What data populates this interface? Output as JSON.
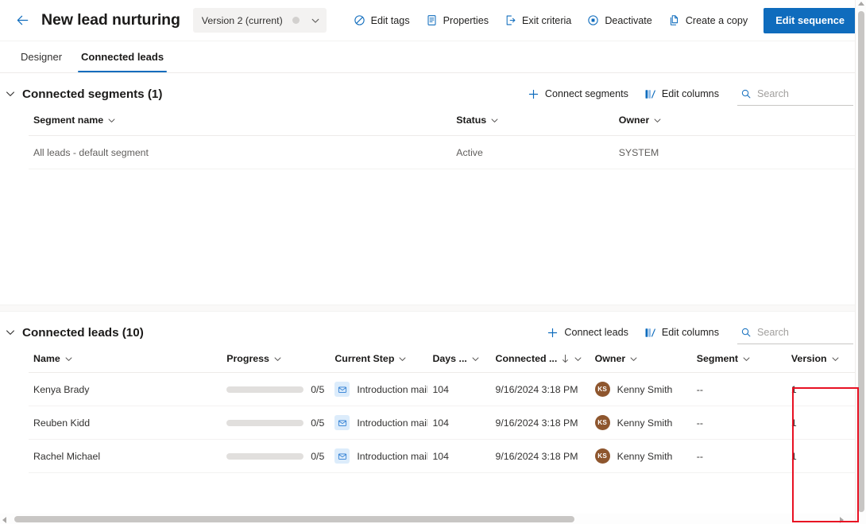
{
  "header": {
    "back_icon": "arrow-left-icon",
    "title": "New lead nurturing",
    "version_selector": {
      "label": "Version 2 (current)",
      "chevron_icon": "chevron-down-icon"
    },
    "actions": [
      {
        "label": "Edit tags",
        "icon": "tag-icon"
      },
      {
        "label": "Properties",
        "icon": "document-properties-icon"
      },
      {
        "label": "Exit criteria",
        "icon": "exit-icon"
      },
      {
        "label": "Deactivate",
        "icon": "circle-stop-icon"
      },
      {
        "label": "Create a copy",
        "icon": "copy-icon"
      }
    ],
    "primary_action": {
      "label": "Edit sequence",
      "color": "#0f6cbd"
    }
  },
  "tabs": [
    {
      "label": "Designer",
      "active": false
    },
    {
      "label": "Connected leads",
      "active": true
    }
  ],
  "segments_section": {
    "title": "Connected segments (1)",
    "chevron_icon": "chevron-down-icon",
    "tools": [
      {
        "label": "Connect segments",
        "icon": "plus-icon"
      },
      {
        "label": "Edit columns",
        "icon": "edit-columns-icon"
      }
    ],
    "search": {
      "placeholder": "Search",
      "value": "",
      "icon": "search-icon"
    },
    "columns": [
      {
        "label": "Segment name",
        "sortable": true
      },
      {
        "label": "Status",
        "sortable": true
      },
      {
        "label": "Owner",
        "sortable": true
      }
    ],
    "rows": [
      {
        "segment_name": "All leads - default segment",
        "status": "Active",
        "owner": "SYSTEM"
      }
    ]
  },
  "leads_section": {
    "title": "Connected leads (10)",
    "chevron_icon": "chevron-down-icon",
    "tools": [
      {
        "label": "Connect leads",
        "icon": "plus-icon"
      },
      {
        "label": "Edit columns",
        "icon": "edit-columns-icon"
      }
    ],
    "search": {
      "placeholder": "Search",
      "value": "",
      "icon": "search-icon"
    },
    "columns": [
      {
        "label": "Name",
        "sorted": false
      },
      {
        "label": "Progress",
        "sorted": false
      },
      {
        "label": "Current Step",
        "sorted": false
      },
      {
        "label": "Days ...",
        "sorted": false
      },
      {
        "label": "Connected ...",
        "sorted": true,
        "sort_direction": "descending",
        "sort_icon": "arrow-down-icon"
      },
      {
        "label": "Owner",
        "sorted": false
      },
      {
        "label": "Segment",
        "sorted": false
      },
      {
        "label": "Version",
        "sorted": false,
        "highlighted": true
      }
    ],
    "rows": [
      {
        "name": "Kenya Brady",
        "progress_text": "0/5",
        "progress_percent": 0,
        "current_step": "Introduction mail",
        "current_step_icon": "mail-icon",
        "days": "104",
        "connected": "9/16/2024 3:18 PM",
        "owner": "Kenny Smith",
        "owner_initials": "KS",
        "segment": "--",
        "version": "1"
      },
      {
        "name": "Reuben Kidd",
        "progress_text": "0/5",
        "progress_percent": 0,
        "current_step": "Introduction mail",
        "current_step_icon": "mail-icon",
        "days": "104",
        "connected": "9/16/2024 3:18 PM",
        "owner": "Kenny Smith",
        "owner_initials": "KS",
        "segment": "--",
        "version": "1"
      },
      {
        "name": "Rachel Michael",
        "progress_text": "0/5",
        "progress_percent": 0,
        "current_step": "Introduction mail",
        "current_step_icon": "mail-icon",
        "days": "104",
        "connected": "9/16/2024 3:18 PM",
        "owner": "Kenny Smith",
        "owner_initials": "KS",
        "segment": "--",
        "version": "1"
      }
    ]
  },
  "annotation": {
    "highlight_color": "#e81123",
    "target_column": "Version"
  },
  "scrollbars": {
    "vertical_icon": "scrollbar-vertical",
    "horizontal_icon": "scrollbar-horizontal"
  }
}
